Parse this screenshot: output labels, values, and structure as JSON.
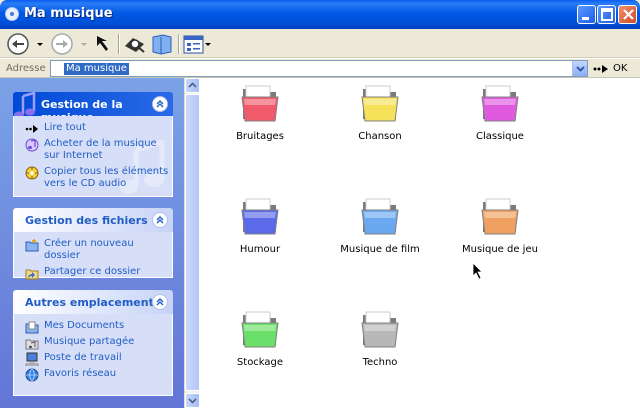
{
  "window": {
    "title": "Ma musique",
    "icon": "music-folder-icon"
  },
  "toolbar": {
    "back_icon": "back-icon",
    "forward_icon": "forward-icon",
    "up_icon": "up-icon",
    "search_icon": "search-icon",
    "folders_icon": "folders-icon",
    "views_icon": "views-icon"
  },
  "address": {
    "label": "Adresse",
    "value": "Ma musique",
    "go_label": "OK"
  },
  "sidebar": {
    "music_tasks": {
      "title": "Gestion de la musique",
      "items": [
        {
          "label": "Lire tout",
          "icon": "play-icon"
        },
        {
          "label": "Acheter de la musique sur Internet",
          "icon": "music-web-icon"
        },
        {
          "label": "Copier tous les éléments vers le CD audio",
          "icon": "cd-burn-icon"
        }
      ]
    },
    "file_tasks": {
      "title": "Gestion des fichiers",
      "items": [
        {
          "label": "Créer un nouveau dossier",
          "icon": "new-folder-icon"
        },
        {
          "label": "Partager ce dossier",
          "icon": "share-folder-icon"
        }
      ]
    },
    "other_places": {
      "title": "Autres emplacements",
      "items": [
        {
          "label": "Mes Documents",
          "icon": "my-documents-icon"
        },
        {
          "label": "Musique partagée",
          "icon": "shared-music-icon"
        },
        {
          "label": "Poste de travail",
          "icon": "my-computer-icon"
        },
        {
          "label": "Favoris réseau",
          "icon": "network-icon"
        }
      ]
    }
  },
  "folders": [
    {
      "label": "Bruitages",
      "color": "#f05a6a"
    },
    {
      "label": "Chanson",
      "color": "#f5e15a"
    },
    {
      "label": "Classique",
      "color": "#e05ae0"
    },
    {
      "label": "Humour",
      "color": "#5a6ae8"
    },
    {
      "label": "Musique de film",
      "color": "#6aa8f0"
    },
    {
      "label": "Musique de jeu",
      "color": "#f0a060"
    },
    {
      "label": "Stockage",
      "color": "#6ae06a"
    },
    {
      "label": "Techno",
      "color": "#b8b8b8"
    }
  ]
}
